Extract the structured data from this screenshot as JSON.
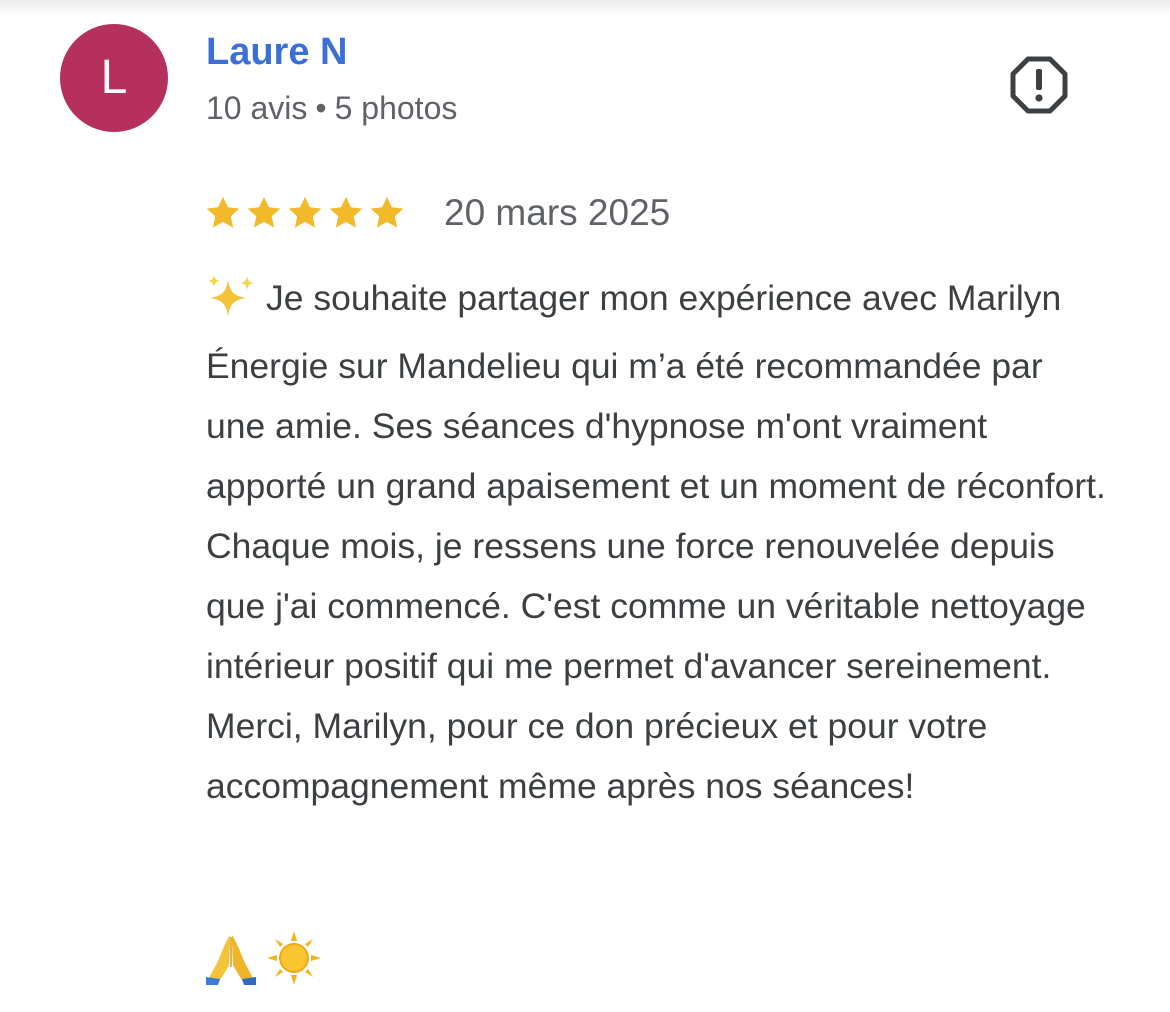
{
  "reviewer": {
    "avatar_letter": "L",
    "avatar_color": "#b5305d",
    "name": "Laure N",
    "reviews_count": "10 avis",
    "separator": "•",
    "photos_count": "5 photos",
    "name_color": "#3b6fd6"
  },
  "actions": {
    "report_icon": "report-flag-icon"
  },
  "review": {
    "rating": 5,
    "rating_max": 5,
    "star_color": "#f2b92b",
    "date": "20 mars 2025",
    "leading_emoji": "sparkles-icon",
    "text": "Je souhaite partager mon expérience avec Marilyn Énergie sur Mandelieu qui m’a été recommandée par une amie. Ses séances d'hypnose m'ont vraiment apporté un grand apaisement et un moment de réconfort. Chaque mois, je ressens une force renouvelée depuis que j'ai commencé. C'est comme un véritable nettoyage intérieur positif qui me permet d'avancer sereinement. Merci, Marilyn, pour ce don précieux et pour votre accompagnement même après nos séances!",
    "trailing_emojis": [
      "folded-hands-icon",
      "sun-icon"
    ]
  }
}
